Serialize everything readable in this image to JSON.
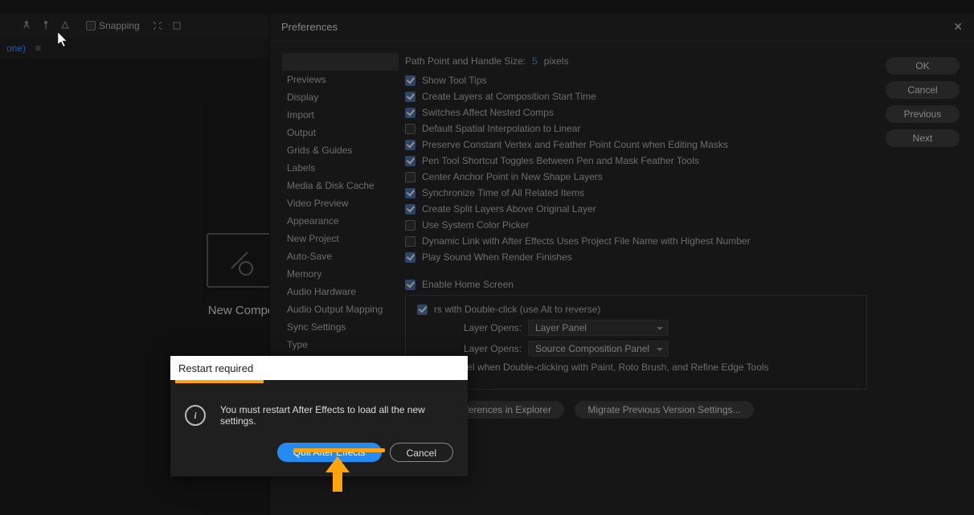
{
  "topbar": {
    "snapping_label": "Snapping"
  },
  "panel": {
    "tab": "one)",
    "menu_glyph": "≡"
  },
  "center": {
    "label": "New Compo"
  },
  "prefs": {
    "title": "Preferences",
    "close_glyph": "✕",
    "categories": [
      "",
      "Previews",
      "Display",
      "Import",
      "Output",
      "Grids & Guides",
      "Labels",
      "Media & Disk Cache",
      "Video Preview",
      "Appearance",
      "New Project",
      "Auto-Save",
      "Memory",
      "Audio Hardware",
      "Audio Output Mapping",
      "Sync Settings",
      "Type"
    ],
    "selected_index": 0,
    "path_point_label": "Path Point and Handle Size:",
    "path_point_value": "5",
    "path_point_unit": "pixels",
    "options": [
      {
        "label": "Show Tool Tips",
        "checked": true
      },
      {
        "label": "Create Layers at Composition Start Time",
        "checked": true
      },
      {
        "label": "Switches Affect Nested Comps",
        "checked": true
      },
      {
        "label": "Default Spatial Interpolation to Linear",
        "checked": false
      },
      {
        "label": "Preserve Constant Vertex and Feather Point Count when Editing Masks",
        "checked": true
      },
      {
        "label": "Pen Tool Shortcut Toggles Between Pen and Mask Feather Tools",
        "checked": true
      },
      {
        "label": "Center Anchor Point in New Shape Layers",
        "checked": false
      },
      {
        "label": "Synchronize Time of All Related Items",
        "checked": true
      },
      {
        "label": "Create Split Layers Above Original Layer",
        "checked": true
      },
      {
        "label": "Use System Color Picker",
        "checked": false
      },
      {
        "label": "Dynamic Link with After Effects Uses Project File Name with Highest Number",
        "checked": false
      },
      {
        "label": "Play Sound When Render Finishes",
        "checked": true
      }
    ],
    "enable_home": {
      "label": "Enable Home Screen",
      "checked": true
    },
    "group": {
      "toggle": {
        "label": "rs with Double-click (use Alt to reverse)",
        "checked": true
      },
      "row1_label": "Layer Opens:",
      "row1_value": "Layer Panel",
      "row2_label": "Layer Opens:",
      "row2_value": "Source Composition Panel",
      "row3": {
        "label": "yer Panel when Double-clicking with Paint, Roto Brush, and Refine Edge Tools",
        "checked": true
      }
    },
    "sub_buttons": {
      "reveal": "Reveal Preferences in Explorer",
      "migrate": "Migrate Previous Version Settings..."
    },
    "right_buttons": {
      "ok": "OK",
      "cancel": "Cancel",
      "previous": "Previous",
      "next": "Next"
    }
  },
  "modal": {
    "title": "Restart required",
    "message": "You must restart After Effects to load all the new settings.",
    "primary": "Quit After Effects",
    "secondary": "Cancel"
  }
}
